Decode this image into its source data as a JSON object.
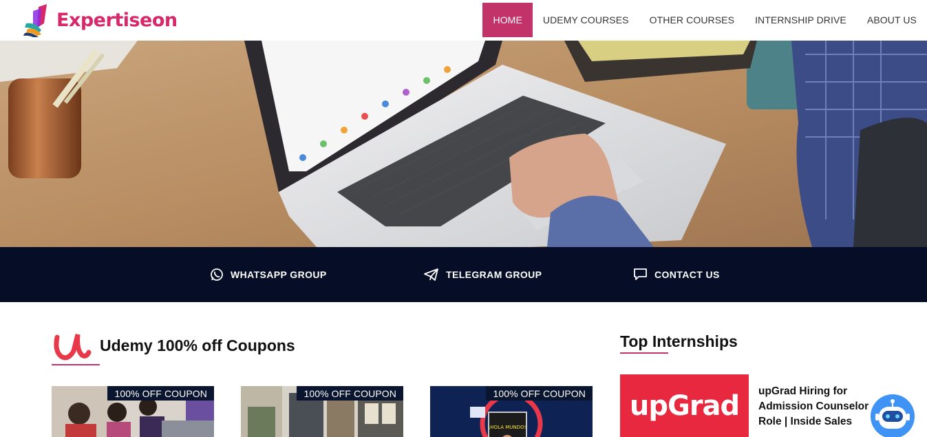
{
  "brand": {
    "name": "Expertiseon",
    "color": "#d6286a"
  },
  "nav": {
    "items": [
      {
        "label": "HOME",
        "active": true
      },
      {
        "label": "UDEMY COURSES",
        "active": false
      },
      {
        "label": "OTHER COURSES",
        "active": false
      },
      {
        "label": "INTERNSHIP DRIVE",
        "active": false
      },
      {
        "label": "ABOUT US",
        "active": false
      }
    ],
    "active_color": "#c2336a"
  },
  "linkbar": {
    "background": "#050e26",
    "items": [
      {
        "label": "WHATSAPP GROUP",
        "icon": "whatsapp-icon"
      },
      {
        "label": "TELEGRAM GROUP",
        "icon": "telegram-icon"
      },
      {
        "label": "CONTACT US",
        "icon": "chat-bubble-icon"
      }
    ]
  },
  "udemy": {
    "title": "Udemy 100% off Coupons",
    "icon": "udemy-logo-icon",
    "cards": [
      {
        "badge": "100% OFF COUPON"
      },
      {
        "badge": "100% OFF COUPON"
      },
      {
        "badge": "100% OFF COUPON"
      }
    ]
  },
  "internships": {
    "title": "Top Internships",
    "items": [
      {
        "logo_text": "upGrad",
        "title": "upGrad Hiring for Admission Counselor Role | Inside Sales"
      }
    ]
  },
  "chatbot": {
    "icon": "chatbot-icon"
  }
}
